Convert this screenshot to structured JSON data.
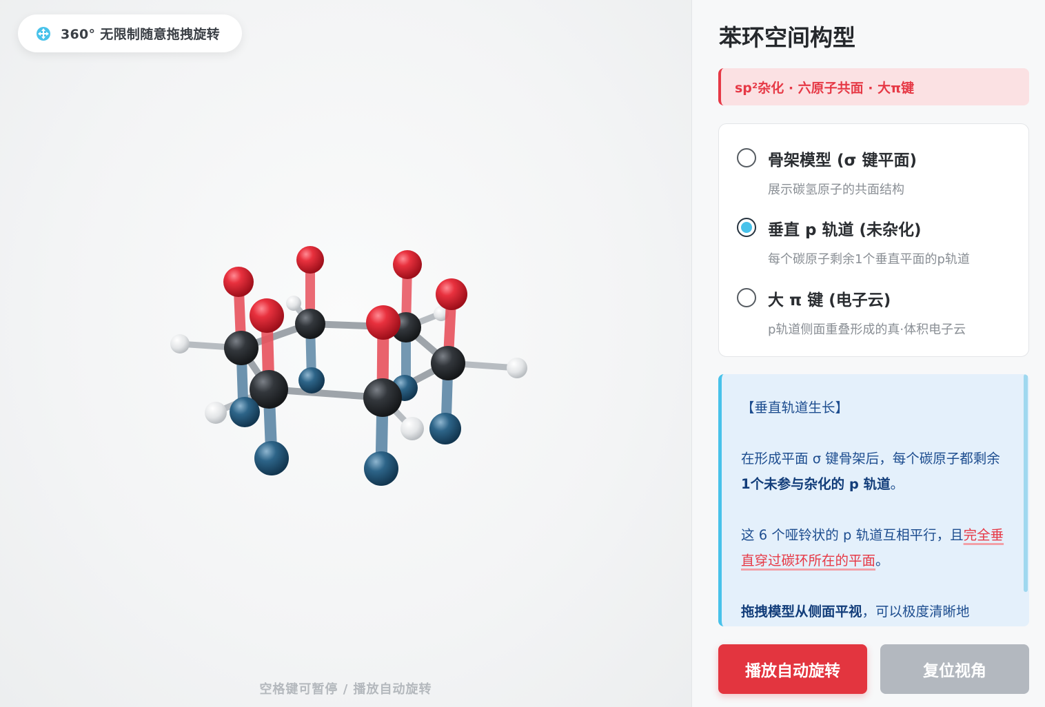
{
  "viewport": {
    "drag_hint": "360° 无限制随意拖拽旋转",
    "footer_hint": "空格键可暂停 / 播放自动旋转"
  },
  "panel": {
    "title": "苯环空间构型",
    "tag": "sp²杂化 · 六原子共面 · 大π键",
    "modes": [
      {
        "label": "骨架模型 (σ 键平面)",
        "desc": "展示碳氢原子的共面结构",
        "checked": false
      },
      {
        "label": "垂直 p 轨道 (未杂化)",
        "desc": "每个碳原子剩余1个垂直平面的p轨道",
        "checked": true
      },
      {
        "label": "大 π 键 (电子云)",
        "desc": "p轨道侧面重叠形成的真·体积电子云",
        "checked": false
      }
    ],
    "info": {
      "heading": "【垂直轨道生长】",
      "p1_a": "在形成平面 σ 键骨架后，每个碳原子都剩余 ",
      "p1_b": "1个未参与杂化的 p 轨道",
      "p1_c": "。",
      "p2_a": "这 6 个哑铃状的 p 轨道互相平行，且",
      "p2_b": "完全垂直穿过碳环所在的平面",
      "p2_c": "。",
      "p3_a": "拖拽模型从侧面平视",
      "p3_b": "，可以极度清晰地"
    },
    "buttons": {
      "play": "播放自动旋转",
      "reset": "复位视角"
    }
  },
  "colors": {
    "accent_red": "#e63946",
    "accent_cyan": "#48c2ea",
    "carbon": "#2f3338",
    "orbital_top": "#e8424f",
    "orbital_bottom": "#2f6a8e",
    "hydrogen": "#e6e8ea"
  }
}
